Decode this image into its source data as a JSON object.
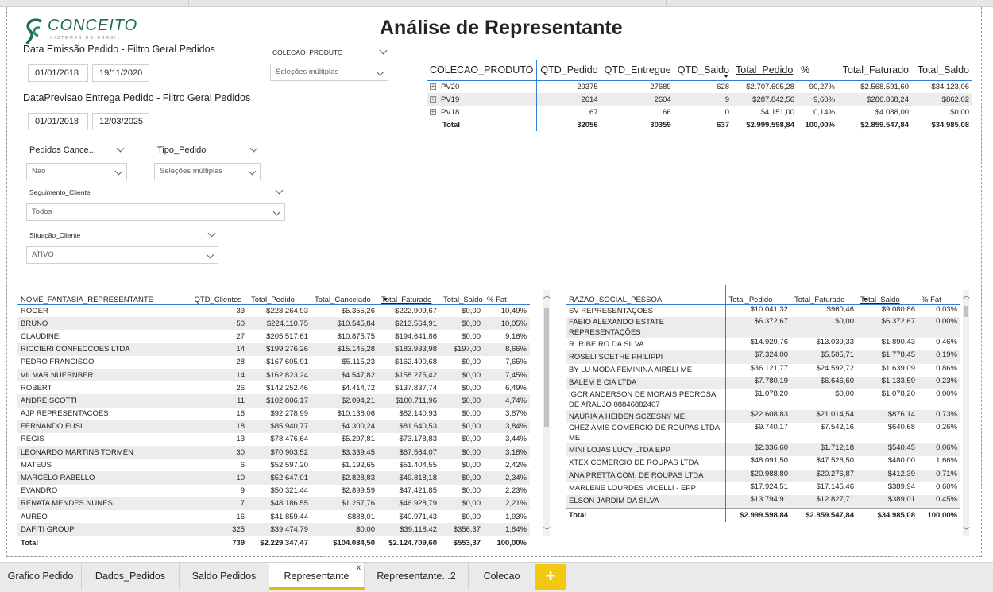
{
  "title": "Análise de Representante",
  "logo": {
    "word": "CONCEITO",
    "sub": "SISTEMAS DO BRASIL"
  },
  "filters": {
    "emissao_label": "Data Emissão Pedido - Filtro Geral Pedidos",
    "emissao_start": "01/01/2018",
    "emissao_end": "19/11/2020",
    "previsao_label": "DataPrevisao Entrega Pedido - Filtro Geral Pedidos",
    "previsao_start": "01/01/2018",
    "previsao_end": "12/03/2025",
    "colecao_label": "COLECAO_PRODUTO",
    "colecao_value": "Seleções múltiplas",
    "cancelados_label": "Pedidos Cance...",
    "cancelados_value": "Nao",
    "tipo_label": "Tipo_Pedido",
    "tipo_value": "Seleções múltiplas",
    "seguimento_label": "Seguimento_Cliente",
    "seguimento_value": "Todos",
    "situacao_label": "Situação_Cliente",
    "situacao_value": "ATIVO"
  },
  "summary": {
    "headers": [
      "COLECAO_PRODUTO",
      "QTD_Pedido",
      "QTD_Entregue",
      "QTD_Saldo",
      "Total_Pedido",
      "%",
      "Total_Faturado",
      "Total_Saldo"
    ],
    "rows": [
      [
        "PV20",
        "29375",
        "27689",
        "628",
        "$2.707.605,28",
        "90,27%",
        "$2.568.591,60",
        "$34.123,06"
      ],
      [
        "PV19",
        "2614",
        "2604",
        "9",
        "$287.842,56",
        "9,60%",
        "$286.868,24",
        "$862,02"
      ],
      [
        "PV18",
        "67",
        "66",
        "0",
        "$4.151,00",
        "0,14%",
        "$4.088,00",
        "$0,00"
      ]
    ],
    "total": [
      "Total",
      "32056",
      "30359",
      "637",
      "$2.999.598,84",
      "100,00%",
      "$2.859.547,84",
      "$34.985,08"
    ]
  },
  "rep_table": {
    "headers": [
      "NOME_FANTASIA_REPRESENTANTE",
      "QTD_Clientes",
      "Total_Pedido",
      "Total_Cancelado",
      "Total_Faturado",
      "Total_Saldo",
      "% Fat"
    ],
    "rows": [
      [
        "ROGER",
        "33",
        "$228.264,93",
        "$5.355,26",
        "$222.909,67",
        "$0,00",
        "10,49%"
      ],
      [
        "BRUNO",
        "50",
        "$224.110,75",
        "$10.545,84",
        "$213.564,91",
        "$0,00",
        "10,05%"
      ],
      [
        "CLAUDINEI",
        "27",
        "$205.517,61",
        "$10.875,75",
        "$194.641,86",
        "$0,00",
        "9,16%"
      ],
      [
        "RICCIERI CONFECCOES LTDA",
        "14",
        "$199.276,26",
        "$15.145,28",
        "$183.933,98",
        "$197,00",
        "8,66%"
      ],
      [
        "PEDRO FRANCISCO",
        "28",
        "$167.605,91",
        "$5.115,23",
        "$162.490,68",
        "$0,00",
        "7,65%"
      ],
      [
        "VILMAR NUERNBER",
        "14",
        "$162.823,24",
        "$4.547,82",
        "$158.275,42",
        "$0,00",
        "7,45%"
      ],
      [
        "ROBERT",
        "26",
        "$142.252,46",
        "$4.414,72",
        "$137.837,74",
        "$0,00",
        "6,49%"
      ],
      [
        "ANDRE SCOTTI",
        "11",
        "$102.806,17",
        "$2.094,21",
        "$100.711,96",
        "$0,00",
        "4,74%"
      ],
      [
        "AJP REPRESENTACOES",
        "16",
        "$92.278,99",
        "$10.138,06",
        "$82.140,93",
        "$0,00",
        "3,87%"
      ],
      [
        "FERNANDO FUSI",
        "18",
        "$85.940,77",
        "$4.300,24",
        "$81.640,53",
        "$0,00",
        "3,84%"
      ],
      [
        "REGIS",
        "13",
        "$78.476,64",
        "$5.297,81",
        "$73.178,83",
        "$0,00",
        "3,44%"
      ],
      [
        "LEONARDO MARTINS TORMEN",
        "30",
        "$70.903,52",
        "$3.339,45",
        "$67.564,07",
        "$0,00",
        "3,18%"
      ],
      [
        "MATEUS",
        "6",
        "$52.597,20",
        "$1.192,65",
        "$51.404,55",
        "$0,00",
        "2,42%"
      ],
      [
        "MARCELO RABELLO",
        "10",
        "$52.647,01",
        "$2.828,83",
        "$49.818,18",
        "$0,00",
        "2,34%"
      ],
      [
        "EVANDRO",
        "9",
        "$50.321,44",
        "$2.899,59",
        "$47.421,85",
        "$0,00",
        "2,23%"
      ],
      [
        "RENATA MENDES NUNES",
        "7",
        "$48.186,55",
        "$1.257,76",
        "$46.928,79",
        "$0,00",
        "2,21%"
      ],
      [
        "AUREO",
        "16",
        "$41.859,44",
        "$888,01",
        "$40.971,43",
        "$0,00",
        "1,93%"
      ],
      [
        "DAFITI GROUP",
        "325",
        "$39.474,79",
        "$0,00",
        "$39.118,42",
        "$356,37",
        "1,84%"
      ]
    ],
    "total": [
      "Total",
      "739",
      "$2.229.347,47",
      "$104.084,50",
      "$2.124.709,60",
      "$553,37",
      "100,00%"
    ]
  },
  "client_table": {
    "headers": [
      "RAZAO_SOCIAL_PESSOA",
      "Total_Pedido",
      "Total_Faturado",
      "Total_Saldo",
      "% Fat"
    ],
    "rows": [
      [
        "SV REPRESENTAÇOES",
        "$10.041,32",
        "$960,46",
        "$9.080,86",
        "0,03%"
      ],
      [
        "FABIO ALEXANDO ESTATE REPRESENTAÇÕES",
        "$6.372,67",
        "$0,00",
        "$6.372,67",
        "0,00%"
      ],
      [
        "R. RIBEIRO DA SILVA",
        "$14.929,76",
        "$13.039,33",
        "$1.890,43",
        "0,46%"
      ],
      [
        "ROSELI SOETHE PHILIPPI",
        "$7.324,00",
        "$5.505,71",
        "$1.778,45",
        "0,19%"
      ],
      [
        "BY LU MODA FEMININA AIRELI-ME",
        "$36.121,77",
        "$24.592,72",
        "$1.639,09",
        "0,86%"
      ],
      [
        "BALEM E CIA LTDA",
        "$7.780,19",
        "$6.646,60",
        "$1.133,59",
        "0,23%"
      ],
      [
        "IGOR ANDERSON DE MORAIS PEDROSA DE ARAUJO 08846882407",
        "$1.078,20",
        "$0,00",
        "$1.078,20",
        "0,00%"
      ],
      [
        "NAURIA A HEIDEN SCZESNY ME",
        "$22.608,83",
        "$21.014,54",
        "$876,14",
        "0,73%"
      ],
      [
        "CHEZ AMIS COMERCIO DE ROUPAS LTDA ME",
        "$9.740,17",
        "$7.542,16",
        "$640,68",
        "0,26%"
      ],
      [
        "MINI LOJAS LUCY LTDA EPP",
        "$2.336,60",
        "$1.712,18",
        "$540,45",
        "0,06%"
      ],
      [
        "XTEX COMERCIO DE ROUPAS LTDA",
        "$48.091,50",
        "$47.526,50",
        "$480,00",
        "1,66%"
      ],
      [
        "ANA PRETTA COM. DE ROUPAS LTDA",
        "$20.988,80",
        "$20.276,87",
        "$412,39",
        "0,71%"
      ],
      [
        "MARLENE LOURDES VICELLI - EPP",
        "$17.924,51",
        "$17.145,46",
        "$389,94",
        "0,60%"
      ],
      [
        "ELSON JARDIM DA SILVA",
        "$13.794,91",
        "$12.827,71",
        "$389,01",
        "0,45%"
      ]
    ],
    "total": [
      "Total",
      "$2.999.598,84",
      "$2.859.547,84",
      "$34.985,08",
      "100,00%"
    ]
  },
  "tabs": [
    "Grafico Pedido",
    "Dados_Pedidos",
    "Saldo Pedidos",
    "Representante",
    "Representante...2",
    "Colecao"
  ],
  "active_tab": "Representante",
  "add_tab_label": "+",
  "close_label": "x",
  "colors": {
    "accent": "#2f7fd6",
    "tab_add": "#f2c811",
    "active_underline": "#e8b80a",
    "brand": "#1f6b55"
  }
}
